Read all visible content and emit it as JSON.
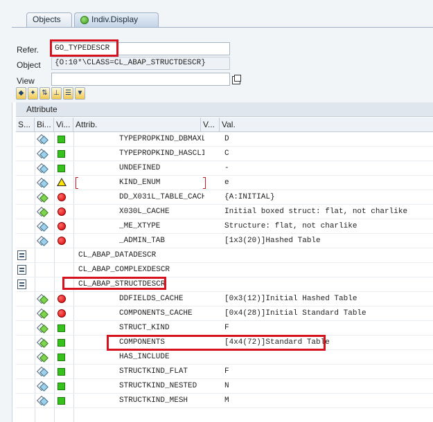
{
  "tabs": [
    {
      "label": "Objects"
    },
    {
      "label": "Indiv.Display"
    }
  ],
  "form": {
    "refer_label": "Refer.",
    "refer_value": "GO_TYPEDESCR",
    "object_label": "Object",
    "object_value": "{O:10*\\CLASS=CL_ABAP_STRUCTDESCR}",
    "view_label": "View",
    "view_value": ""
  },
  "grid": {
    "title": "Attribute",
    "columns": [
      "S...",
      "Bi...",
      "Vi...",
      "Attrib.",
      "V...",
      "Val."
    ],
    "rows": [
      {
        "name": "TYPEPROPKIND_DBMAXL...",
        "value": "D",
        "binding": "tag-blue",
        "visibility": "green",
        "indent": 1
      },
      {
        "name": "TYPEPROPKIND_HASCLI...",
        "value": "C",
        "binding": "tag-blue",
        "visibility": "green",
        "indent": 1
      },
      {
        "name": "UNDEFINED",
        "value": "-",
        "binding": "tag-blue",
        "visibility": "green",
        "indent": 1
      },
      {
        "name": "KIND_ENUM",
        "value": "e",
        "binding": "tag-blue",
        "visibility": "warning",
        "indent": 1
      },
      {
        "name": "DD_X031L_TABLE_CACHE",
        "value": "{A:INITIAL}",
        "binding": "tag-green",
        "visibility": "red",
        "indent": 1
      },
      {
        "name": "X030L_CACHE",
        "value": "Initial boxed struct: flat, not charlike",
        "binding": "tag-green",
        "visibility": "red",
        "indent": 1
      },
      {
        "name": "_ME_XTYPE",
        "value": "Structure: flat, not charlike",
        "binding": "tag-blue",
        "visibility": "red",
        "indent": 1
      },
      {
        "name": "_ADMIN_TAB",
        "value": "[1x3(20)]Hashed Table",
        "binding": "tag-blue",
        "visibility": "red",
        "indent": 1
      },
      {
        "name": "CL_ABAP_DATADESCR",
        "value": "",
        "binding": "none",
        "visibility": "none",
        "indent": 0,
        "class_icon": true
      },
      {
        "name": "CL_ABAP_COMPLEXDESCR",
        "value": "",
        "binding": "none",
        "visibility": "none",
        "indent": 0,
        "class_icon": true
      },
      {
        "name": "CL_ABAP_STRUCTDESCR",
        "value": "",
        "binding": "none",
        "visibility": "none",
        "indent": 0,
        "class_icon": true
      },
      {
        "name": "DDFIELDS_CACHE",
        "value": "[0x3(12)]Initial Hashed Table",
        "binding": "tag-green",
        "visibility": "red",
        "indent": 1
      },
      {
        "name": "COMPONENTS_CACHE",
        "value": "[0x4(28)]Initial Standard Table",
        "binding": "tag-green",
        "visibility": "red",
        "indent": 1
      },
      {
        "name": "STRUCT_KIND",
        "value": "F",
        "binding": "tag-green",
        "visibility": "green",
        "indent": 1
      },
      {
        "name": "COMPONENTS",
        "value": "[4x4(72)]Standard Table",
        "binding": "tag-green",
        "visibility": "green",
        "indent": 1
      },
      {
        "name": "HAS_INCLUDE",
        "value": "",
        "binding": "tag-green",
        "visibility": "green",
        "indent": 1
      },
      {
        "name": "STRUCTKIND_FLAT",
        "value": "F",
        "binding": "tag-blue",
        "visibility": "green",
        "indent": 1
      },
      {
        "name": "STRUCTKIND_NESTED",
        "value": "N",
        "binding": "tag-blue",
        "visibility": "green",
        "indent": 1
      },
      {
        "name": "STRUCTKIND_MESH",
        "value": "M",
        "binding": "tag-blue",
        "visibility": "green",
        "indent": 1
      }
    ]
  },
  "colors": {
    "highlight": "#d5121d",
    "ok": "#35c21a",
    "error": "#d80000",
    "warning": "#ffe600"
  }
}
